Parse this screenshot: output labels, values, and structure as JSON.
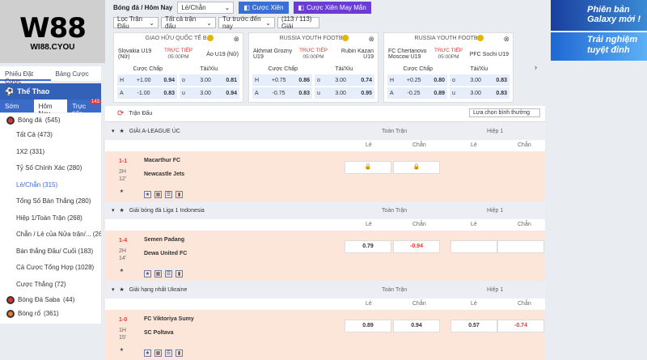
{
  "logo": {
    "brand": "W88",
    "site": "WI88.CYOU"
  },
  "topbar": {
    "crumb": "Bóng đá / Hôm Nay",
    "select": "Lẻ/Chẵn",
    "cuoc_xien": "Cược Xiên",
    "may_man": "Cược Xiên May Mắn"
  },
  "filters": {
    "f1": "Lọc Trận Đấu",
    "f2": "Tất cả trận đấu",
    "f3": "Tư trước đến nay",
    "count": "(113 / 113) Giải"
  },
  "left_tabs": [
    "Phiếu Đặt Cược",
    "Bảng Cược"
  ],
  "side": {
    "title": "Thể Thao",
    "tabs": [
      "Sớm",
      "Hôm Nay",
      "Trực tiếp"
    ],
    "badge": "143",
    "sports": [
      {
        "name": "Bóng đá",
        "count": "(545)"
      },
      {
        "name": "Bóng Đá Saba",
        "count": "(44)"
      },
      {
        "name": "Bóng rổ",
        "count": "(361)"
      }
    ],
    "items": [
      "Tất Cả (473)",
      "1X2 (331)",
      "Tỷ Số Chính Xác (280)",
      "Lẻ/Chẵn (315)",
      "Tổng Số Bàn Thắng (280)",
      "Hiệp 1/Toàn Trận (268)",
      "Chẵn / Lẻ của Nửa trận/...  (263)",
      "Bàn thắng Đầu/ Cuối (183)",
      "Cả Cược Tổng Hợp (1028)",
      "Cược Thắng (72)"
    ]
  },
  "cards": [
    {
      "comp": "GIAO HỮU QUỐC TẾ B...",
      "home": "Slovakia U19 (Nữ)",
      "away": "Áo U19 (Nữ)",
      "live": "TRỰC TIẾP",
      "time": "05:00PM",
      "h_label": "Cược Chấp",
      "t_label": "Tài/Xỉu",
      "r1": [
        "H",
        "+1.00",
        "0.94",
        "o",
        "3.00",
        "0.81"
      ],
      "r2": [
        "A",
        "-1.00",
        "0.83",
        "u",
        "3.00",
        "0.94"
      ]
    },
    {
      "comp": "RUSSIA YOUTH FOOTB...",
      "home": "Akhmat Grozny U19",
      "away": "Rubin Kazan U19",
      "live": "TRỰC TIẾP",
      "time": "05:00PM",
      "h_label": "Cược Chấp",
      "t_label": "Tài/Xỉu",
      "r1": [
        "H",
        "+0.75",
        "0.86",
        "o",
        "3.00",
        "0.74"
      ],
      "r2": [
        "A",
        "-0.75",
        "0.83",
        "u",
        "3.00",
        "0.95"
      ]
    },
    {
      "comp": "RUSSIA YOUTH FOOTB...",
      "home": "FC Chertanovo Moscow U19",
      "away": "PFC Sochi U19",
      "live": "TRỰC TIẾP",
      "time": "05:00PM",
      "h_label": "Cược Chấp",
      "t_label": "Tài/Xỉu",
      "r1": [
        "H",
        "+0.25",
        "0.80",
        "o",
        "3.00",
        "0.83"
      ],
      "r2": [
        "A",
        "-0.25",
        "0.89",
        "u",
        "3.00",
        "0.83"
      ]
    }
  ],
  "banners": {
    "b1": "Phiên bản Galaxy mới !",
    "b2": "Trải nghiệm tuyệt đỉnh"
  },
  "main": {
    "title": "Trận Đấu",
    "sort": "Lựa chọn bình thường",
    "full": "Toàn Trận",
    "half": "Hiệp 1",
    "le": "Lẻ",
    "chan": "Chẵn",
    "leagues": [
      {
        "name": "GIẢI A-LEAGUE ÚC",
        "score": "1-1",
        "half": "2H",
        "min": "12'",
        "home": "Macarthur FC",
        "away": "Newcastle Jets",
        "o1": "",
        "o2": "",
        "o3": "",
        "o4": ""
      },
      {
        "name": "Giải bóng đá Liga 1 Indonesia",
        "score": "1-4",
        "half": "2H",
        "min": "14'",
        "home": "Semen Padang",
        "away": "Dewa United FC",
        "o1": "0.79",
        "o2": "-0.94",
        "o3": "",
        "o4": ""
      },
      {
        "name": "Giải hạng nhất Ukraine",
        "score": "1-0",
        "half": "1H",
        "min": "15'",
        "home": "FC Viktoriya Sumy",
        "away": "SC Poltava",
        "o1": "0.89",
        "o2": "0.94",
        "o3": "0.57",
        "o4": "-0.74"
      }
    ]
  }
}
